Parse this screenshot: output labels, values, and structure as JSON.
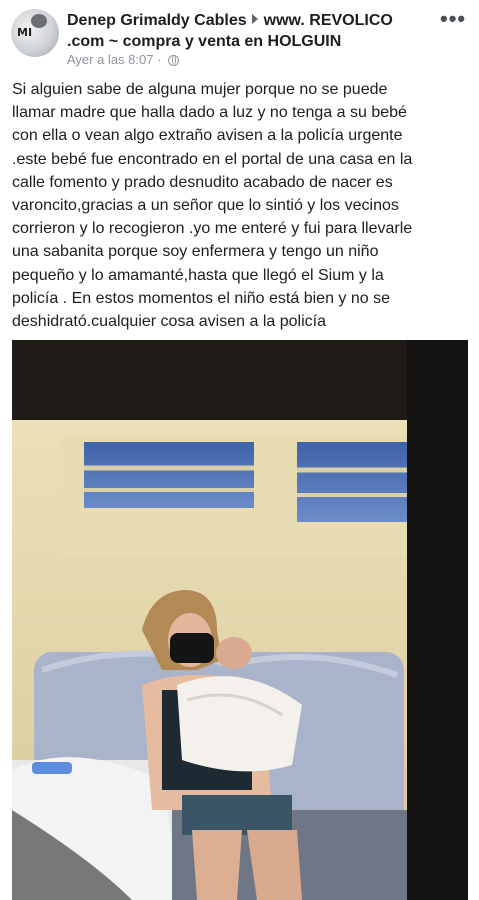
{
  "post": {
    "author": "Denep Grimaldy Cables",
    "group": "www. REVOLICO .com ~ compra y venta en HOLGUIN",
    "timestamp": "Ayer a las 8:07",
    "separator": "·",
    "more_label": "•••",
    "avatar_text": "MI",
    "text_lines": [
      "Si alguien sabe de alguna mujer porque no se puede",
      "llamar madre que halla dado a luz y no tenga a su bebé",
      "con ella o vean algo extraño avisen a la policía urgente",
      ".este bebé fue encontrado en el portal de una casa en la",
      "calle fomento y prado desnudito acabado de nacer es",
      "varoncito,gracias a un señor que lo sintió y los vecinos",
      "corrieron y lo recogieron .yo me enteré y fui para llevarle",
      "una sabanita porque soy enfermera y tengo un niño",
      "pequeño y lo amamanté,hasta que llegó el Sium y la",
      "policía . En estos momentos el niño está bien y no se",
      "deshidrató.cualquier cosa avisen a la policía"
    ]
  },
  "icons": [
    "globe-icon",
    "more-options-icon",
    "caret-right-icon"
  ]
}
